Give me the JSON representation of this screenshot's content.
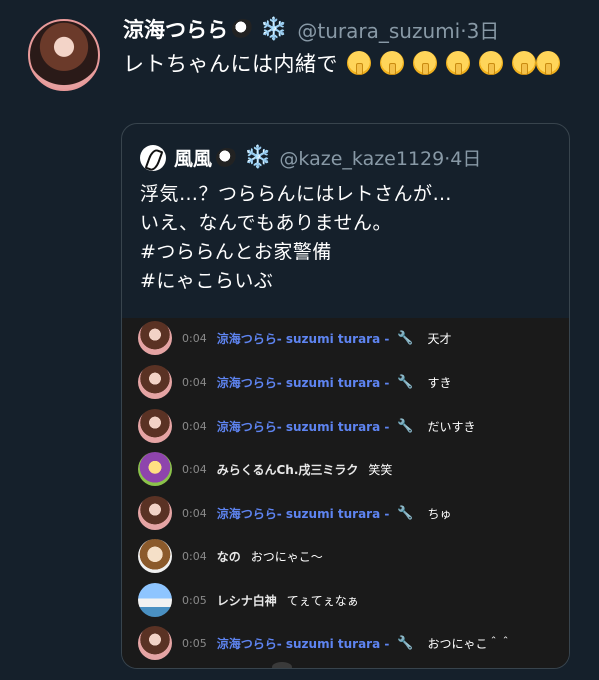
{
  "tweet": {
    "author_name": "涼海つらら",
    "penguin_emoji": "🐧",
    "snow_emoji": "❄️",
    "handle": "@turara_suzumi",
    "separator": "·",
    "age": "3日",
    "text": "レトちゃんには内緒で",
    "shush_emoji_count": 7
  },
  "quote": {
    "author_name": "風風",
    "penguin_emoji": "🐧",
    "snow_emoji": "❄️",
    "handle": "@kaze_kaze1129",
    "separator": "·",
    "age": "4日",
    "lines": [
      "浮気…？つららんにはレトさんが…",
      "いえ、なんでもありません。",
      "#つららんとお家警備",
      "#にゃこらいぶ"
    ]
  },
  "chat": [
    {
      "time": "0:04",
      "author": "涼海つらら- suzumi turara -",
      "moderator": true,
      "message": "天才",
      "avatar": "suzumi"
    },
    {
      "time": "0:04",
      "author": "涼海つらら- suzumi turara -",
      "moderator": true,
      "message": "すき",
      "avatar": "suzumi"
    },
    {
      "time": "0:04",
      "author": "涼海つらら- suzumi turara -",
      "moderator": true,
      "message": "だいすき",
      "avatar": "suzumi"
    },
    {
      "time": "0:04",
      "author": "みらくるんCh.戌三ミラク",
      "moderator": false,
      "message": "笑笑",
      "avatar": "mira"
    },
    {
      "time": "0:04",
      "author": "涼海つらら- suzumi turara -",
      "moderator": true,
      "message": "ちゅ",
      "avatar": "suzumi"
    },
    {
      "time": "0:04",
      "author": "なの",
      "moderator": false,
      "message": "おつにゃこ～",
      "avatar": "nano"
    },
    {
      "time": "0:05",
      "author": "レシナ白神",
      "moderator": false,
      "message": "てぇてぇなぁ",
      "avatar": "reshina"
    },
    {
      "time": "0:05",
      "author": "涼海つらら- suzumi turara -",
      "moderator": true,
      "message": "おつにゃこ＾＾",
      "avatar": "suzumi"
    }
  ],
  "icons": {
    "moderator": "wrench-icon"
  },
  "colors": {
    "background": "#15202b",
    "chat_background": "#1a1a1a",
    "moderator_name": "#5e84f1",
    "handle": "#8899a6"
  }
}
